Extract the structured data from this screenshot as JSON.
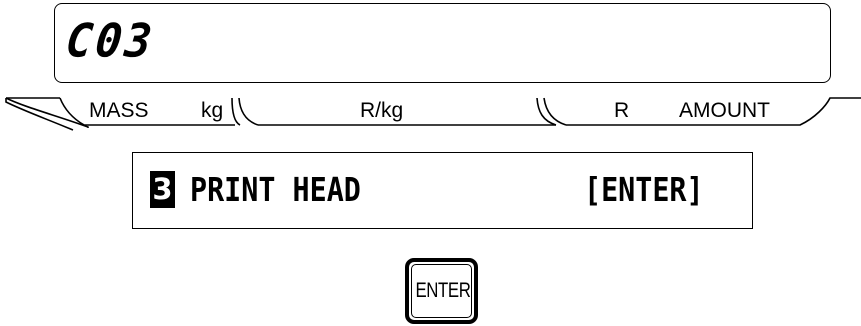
{
  "display": {
    "code": "C03"
  },
  "labels": {
    "mass": "MASS",
    "kg": "kg",
    "price_per_kg": "R/kg",
    "currency": "R",
    "amount": "AMOUNT"
  },
  "lcd": {
    "step_number": "3",
    "menu_item": "PRINT HEAD",
    "hint": "[ENTER]"
  },
  "keys": {
    "enter_label": "ENTER"
  }
}
